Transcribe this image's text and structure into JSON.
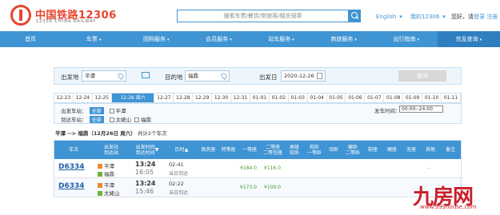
{
  "brand": {
    "name": "中国铁路12306",
    "name_en": "12306 CHINA RAILWAY",
    "color": "#e8442f"
  },
  "search": {
    "placeholder": "搜索车票/餐饮/常旅客/相关规章"
  },
  "top_links": {
    "lang": "English",
    "lang_caret": "▾",
    "my": "我的12306",
    "my_caret": "▾",
    "hello": "您好，请",
    "login": "登录",
    "register": "注册"
  },
  "nav": [
    {
      "label": "首页",
      "caret": ""
    },
    {
      "label": "车票",
      "caret": "▾"
    },
    {
      "label": "团购服务",
      "caret": "▾"
    },
    {
      "label": "会员服务",
      "caret": "▾"
    },
    {
      "label": "站车服务",
      "caret": "▾"
    },
    {
      "label": "商旅服务",
      "caret": "▾"
    },
    {
      "label": "出行指南",
      "caret": "▾"
    },
    {
      "label": "信息查询",
      "caret": "▾"
    }
  ],
  "form": {
    "from_label": "出发地",
    "from_value": "平潭",
    "to_label": "目的地",
    "to_value": "福鼎",
    "date_label": "出发日",
    "date_value": "2020-12-26",
    "query_label": "查询"
  },
  "date_tabs": [
    "12-23",
    "12-24",
    "12-25",
    "12-26 周六",
    "12-27",
    "12-28",
    "12-29",
    "12-30",
    "12-31",
    "01-01",
    "01-02",
    "01-03",
    "01-04",
    "01-05",
    "01-06",
    "01-07",
    "01-08",
    "01-09",
    "01-10",
    "01-11"
  ],
  "active_date_index": 3,
  "filter": {
    "from_station_label": "出发车站：",
    "to_station_label": "到达车站：",
    "all_label": "全部",
    "from_options": [
      "平潭"
    ],
    "to_options": [
      "太姥山",
      "福鼎"
    ],
    "time_label": "发车时间：",
    "time_value": "00:00--24:00"
  },
  "summary": {
    "route": "平潭 --> 福鼎",
    "date": "（12月26日 周六）",
    "count": "共计2个车次"
  },
  "table_headers": [
    "车次",
    "出发站\n到达站",
    "出发时间\n到达时间",
    "历时",
    "商务座",
    "特等座",
    "一等座",
    "二等座\n二等包座",
    "高级\n软卧",
    "软卧\n一等卧",
    "动卧",
    "硬卧\n二等卧",
    "软座",
    "硬座",
    "无座",
    "其他",
    "备注"
  ],
  "table_header_sort_marks": {
    "depart_time": "▼",
    "duration": "▲"
  },
  "rows": [
    {
      "train": "D6334",
      "from": "平潭",
      "to": "福鼎",
      "depart": "13:24",
      "arrive": "16:05",
      "duration": "02:41",
      "arrival_note": "当日到达",
      "first": "¥184.0",
      "second": "¥116.0",
      "other": "--"
    },
    {
      "train": "D6334",
      "from": "平潭",
      "to": "太姥山",
      "depart": "13:24",
      "arrive": "15:46",
      "duration": "02:22",
      "arrival_note": "当日到达",
      "first": "¥173.0",
      "second": "¥109.0"
    }
  ],
  "watermark": {
    "text": "九房网",
    "url": "www.999house.com"
  },
  "colors": {
    "primary": "#3f94d3",
    "price": "#4a9b2f",
    "accent": "#c8202a"
  }
}
